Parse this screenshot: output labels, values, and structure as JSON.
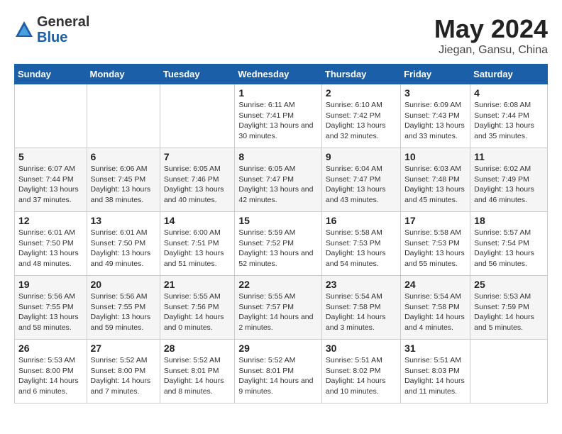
{
  "logo": {
    "general": "General",
    "blue": "Blue"
  },
  "header": {
    "month": "May 2024",
    "location": "Jiegan, Gansu, China"
  },
  "days_of_week": [
    "Sunday",
    "Monday",
    "Tuesday",
    "Wednesday",
    "Thursday",
    "Friday",
    "Saturday"
  ],
  "weeks": [
    [
      {
        "day": "",
        "info": ""
      },
      {
        "day": "",
        "info": ""
      },
      {
        "day": "",
        "info": ""
      },
      {
        "day": "1",
        "info": "Sunrise: 6:11 AM\nSunset: 7:41 PM\nDaylight: 13 hours\nand 30 minutes."
      },
      {
        "day": "2",
        "info": "Sunrise: 6:10 AM\nSunset: 7:42 PM\nDaylight: 13 hours\nand 32 minutes."
      },
      {
        "day": "3",
        "info": "Sunrise: 6:09 AM\nSunset: 7:43 PM\nDaylight: 13 hours\nand 33 minutes."
      },
      {
        "day": "4",
        "info": "Sunrise: 6:08 AM\nSunset: 7:44 PM\nDaylight: 13 hours\nand 35 minutes."
      }
    ],
    [
      {
        "day": "5",
        "info": "Sunrise: 6:07 AM\nSunset: 7:44 PM\nDaylight: 13 hours\nand 37 minutes."
      },
      {
        "day": "6",
        "info": "Sunrise: 6:06 AM\nSunset: 7:45 PM\nDaylight: 13 hours\nand 38 minutes."
      },
      {
        "day": "7",
        "info": "Sunrise: 6:05 AM\nSunset: 7:46 PM\nDaylight: 13 hours\nand 40 minutes."
      },
      {
        "day": "8",
        "info": "Sunrise: 6:05 AM\nSunset: 7:47 PM\nDaylight: 13 hours\nand 42 minutes."
      },
      {
        "day": "9",
        "info": "Sunrise: 6:04 AM\nSunset: 7:47 PM\nDaylight: 13 hours\nand 43 minutes."
      },
      {
        "day": "10",
        "info": "Sunrise: 6:03 AM\nSunset: 7:48 PM\nDaylight: 13 hours\nand 45 minutes."
      },
      {
        "day": "11",
        "info": "Sunrise: 6:02 AM\nSunset: 7:49 PM\nDaylight: 13 hours\nand 46 minutes."
      }
    ],
    [
      {
        "day": "12",
        "info": "Sunrise: 6:01 AM\nSunset: 7:50 PM\nDaylight: 13 hours\nand 48 minutes."
      },
      {
        "day": "13",
        "info": "Sunrise: 6:01 AM\nSunset: 7:50 PM\nDaylight: 13 hours\nand 49 minutes."
      },
      {
        "day": "14",
        "info": "Sunrise: 6:00 AM\nSunset: 7:51 PM\nDaylight: 13 hours\nand 51 minutes."
      },
      {
        "day": "15",
        "info": "Sunrise: 5:59 AM\nSunset: 7:52 PM\nDaylight: 13 hours\nand 52 minutes."
      },
      {
        "day": "16",
        "info": "Sunrise: 5:58 AM\nSunset: 7:53 PM\nDaylight: 13 hours\nand 54 minutes."
      },
      {
        "day": "17",
        "info": "Sunrise: 5:58 AM\nSunset: 7:53 PM\nDaylight: 13 hours\nand 55 minutes."
      },
      {
        "day": "18",
        "info": "Sunrise: 5:57 AM\nSunset: 7:54 PM\nDaylight: 13 hours\nand 56 minutes."
      }
    ],
    [
      {
        "day": "19",
        "info": "Sunrise: 5:56 AM\nSunset: 7:55 PM\nDaylight: 13 hours\nand 58 minutes."
      },
      {
        "day": "20",
        "info": "Sunrise: 5:56 AM\nSunset: 7:55 PM\nDaylight: 13 hours\nand 59 minutes."
      },
      {
        "day": "21",
        "info": "Sunrise: 5:55 AM\nSunset: 7:56 PM\nDaylight: 14 hours\nand 0 minutes."
      },
      {
        "day": "22",
        "info": "Sunrise: 5:55 AM\nSunset: 7:57 PM\nDaylight: 14 hours\nand 2 minutes."
      },
      {
        "day": "23",
        "info": "Sunrise: 5:54 AM\nSunset: 7:58 PM\nDaylight: 14 hours\nand 3 minutes."
      },
      {
        "day": "24",
        "info": "Sunrise: 5:54 AM\nSunset: 7:58 PM\nDaylight: 14 hours\nand 4 minutes."
      },
      {
        "day": "25",
        "info": "Sunrise: 5:53 AM\nSunset: 7:59 PM\nDaylight: 14 hours\nand 5 minutes."
      }
    ],
    [
      {
        "day": "26",
        "info": "Sunrise: 5:53 AM\nSunset: 8:00 PM\nDaylight: 14 hours\nand 6 minutes."
      },
      {
        "day": "27",
        "info": "Sunrise: 5:52 AM\nSunset: 8:00 PM\nDaylight: 14 hours\nand 7 minutes."
      },
      {
        "day": "28",
        "info": "Sunrise: 5:52 AM\nSunset: 8:01 PM\nDaylight: 14 hours\nand 8 minutes."
      },
      {
        "day": "29",
        "info": "Sunrise: 5:52 AM\nSunset: 8:01 PM\nDaylight: 14 hours\nand 9 minutes."
      },
      {
        "day": "30",
        "info": "Sunrise: 5:51 AM\nSunset: 8:02 PM\nDaylight: 14 hours\nand 10 minutes."
      },
      {
        "day": "31",
        "info": "Sunrise: 5:51 AM\nSunset: 8:03 PM\nDaylight: 14 hours\nand 11 minutes."
      },
      {
        "day": "",
        "info": ""
      }
    ]
  ]
}
